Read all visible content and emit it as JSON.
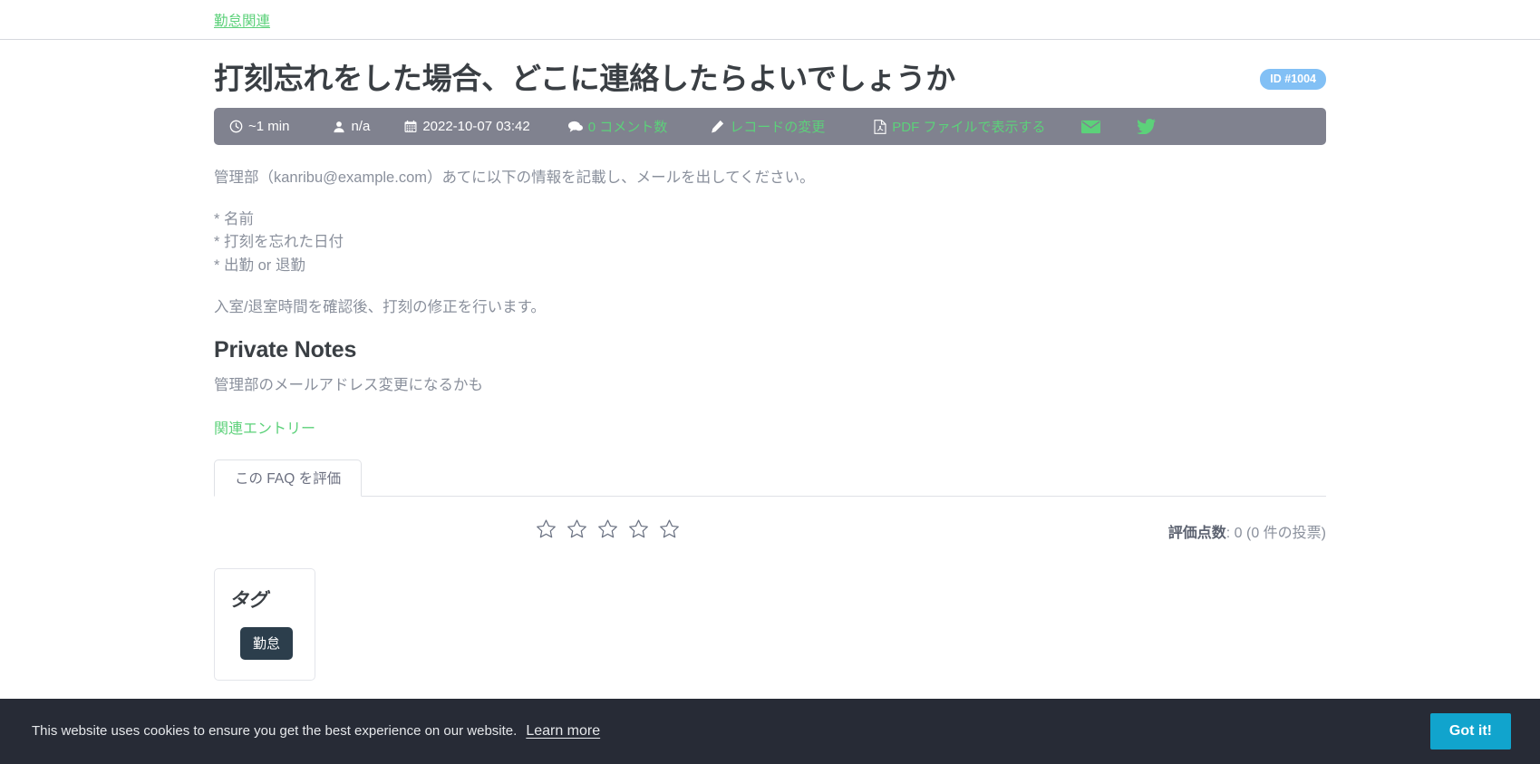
{
  "breadcrumb": {
    "label": "勤怠関連"
  },
  "article": {
    "title": "打刻忘れをした場合、どこに連絡したらよいでしょうか",
    "id_badge": "ID #1004"
  },
  "meta_toolbar": {
    "read_time": "~1 min",
    "author": "n/a",
    "date": "2022-10-07 03:42",
    "comments_label": "0 コメント数",
    "edit_label": "レコードの変更",
    "pdf_label": "PDF ファイルで表示する",
    "email_icon_name": "envelope-icon",
    "twitter_icon_name": "twitter-icon",
    "background_color": "#80828f",
    "link_color": "#5cd17a"
  },
  "body": {
    "intro": "管理部（kanribu@example.com）あてに以下の情報を記載し、メールを出してください。",
    "bullets": [
      "* 名前",
      "* 打刻を忘れた日付",
      "* 出勤 or 退勤"
    ],
    "closing": "入室/退室時間を確認後、打刻の修正を行います。"
  },
  "private_notes": {
    "heading": "Private Notes",
    "text": "管理部のメールアドレス変更になるかも"
  },
  "related": {
    "label": "関連エントリー"
  },
  "tabs": [
    {
      "label": "この FAQ を評価",
      "active": true
    }
  ],
  "rating": {
    "stars_total": 5,
    "stars_filled": 0,
    "score_label": "評価点数",
    "score_value": ": 0 (0 件の投票)"
  },
  "tags": {
    "heading": "タグ",
    "items": [
      "勤怠"
    ]
  },
  "cookie_banner": {
    "message": "This website uses cookies to ensure you get the best experience on our website.",
    "learn_more": "Learn more",
    "accept_label": "Got it!",
    "accept_color": "#11a4cd",
    "background_color": "#272b36"
  }
}
